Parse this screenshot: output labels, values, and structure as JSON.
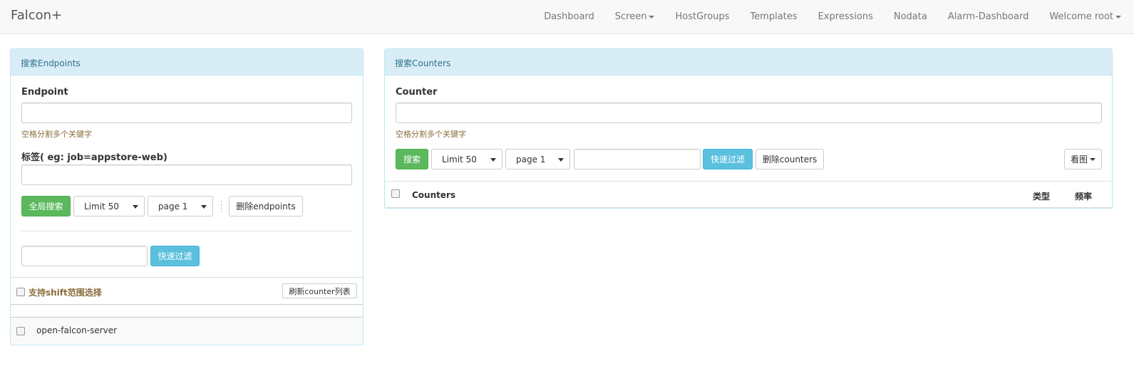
{
  "navbar": {
    "brand": "Falcon+",
    "items": [
      {
        "label": "Dashboard"
      },
      {
        "label": "Screen"
      },
      {
        "label": "HostGroups"
      },
      {
        "label": "Templates"
      },
      {
        "label": "Expressions"
      },
      {
        "label": "Nodata"
      },
      {
        "label": "Alarm-Dashboard"
      },
      {
        "label": "Welcome root"
      }
    ]
  },
  "endpoints_panel": {
    "title": "搜索Endpoints",
    "endpoint_label": "Endpoint",
    "endpoint_value": "",
    "endpoint_help": "空格分割多个关键字",
    "tag_label": "标签( eg: job=appstore-web)",
    "tag_value": "",
    "search_button": "全局搜索",
    "limit_select": "Limit 50",
    "page_select": "page 1",
    "delete_button": "删除endpoints",
    "filter_value": "",
    "filter_button": "快速过滤",
    "shift_select_label": "支持shift范围选择",
    "refresh_button": "刷新counter列表",
    "endpoints": [
      {
        "name": "open-falcon-server"
      }
    ]
  },
  "counters_panel": {
    "title": "搜索Counters",
    "counter_label": "Counter",
    "counter_value": "",
    "counter_help": "空格分割多个关键字",
    "search_button": "搜索",
    "limit_select": "Limit 50",
    "page_select": "page 1",
    "filter_value": "",
    "filter_button": "快速过滤",
    "delete_button": "删除counters",
    "view_button": "看图",
    "table": {
      "col_counters": "Counters",
      "col_type": "类型",
      "col_freq": "频率"
    }
  },
  "colors": {
    "panel_heading_bg": "#d9edf7",
    "panel_heading_text": "#31708f",
    "success": "#5cb85c",
    "info": "#5bc0de",
    "help_text": "#8a6d3b"
  }
}
